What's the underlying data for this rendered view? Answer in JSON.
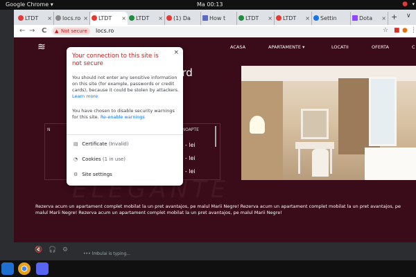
{
  "system": {
    "app_name": "Google Chrome",
    "app_menu_arrow": "▾",
    "clock": "Ma 00:13",
    "status_icon": "●",
    "sysmenu_arrow": "▾"
  },
  "browser": {
    "tabs": [
      {
        "label": "LTDT",
        "favicon_color": "#e53935",
        "active": false
      },
      {
        "label": "locs.ro",
        "favicon_color": "#888888",
        "active": false
      },
      {
        "label": "LTDT",
        "favicon_color": "#e53935",
        "active": true
      },
      {
        "label": "LTDT",
        "favicon_color": "#1e8e3e",
        "active": false
      },
      {
        "label": "(1) Da",
        "favicon_color": "#e53935",
        "active": false
      },
      {
        "label": "How t",
        "favicon_color": "#5c6bc0",
        "active": false
      },
      {
        "label": "LTDT",
        "favicon_color": "#1e8e3e",
        "active": false
      },
      {
        "label": "LTDT",
        "favicon_color": "#e53935",
        "active": false
      },
      {
        "label": "Settin",
        "favicon_color": "#1a73e8",
        "active": false
      },
      {
        "label": "Dota",
        "favicon_color": "#9146ff",
        "active": false
      }
    ],
    "tab_close": "×",
    "new_tab": "+",
    "window_controls": "∨",
    "nav": {
      "back": "←",
      "forward": "→",
      "reload": "C"
    },
    "security_chip": "Not secure",
    "security_warn_icon": "▲",
    "url": "locs.ro",
    "toolbar_icons": {
      "star": "☆",
      "ext1": "■",
      "ext2": "●",
      "profile": "●",
      "menu": "⋮"
    }
  },
  "site": {
    "logo_icon": "≋",
    "nav": [
      "ACASA",
      "APARTAMENTE ▾",
      "LOCATII",
      "OFERTA",
      "C"
    ],
    "heading": "Nord",
    "table_header_left": "N",
    "table_header_right": "TARIF NOAPTE",
    "prices": [
      "- - - lei",
      "- - - lei",
      "- - - lei"
    ],
    "watermark": "ELEGANTE",
    "promo": "Rezerva acum un apartament complet mobilat la un pret avantajos, pe malul Marii Negre! Rezerva acum un apartament complet mobilat la un pret avantajos, pe malul Marii Negre! Rezerva acum un apartament complet mobilat la un pret avantajos, pe malul Marii Negre!"
  },
  "popup": {
    "close": "×",
    "title": "Your connection to this site is not secure",
    "p1": "You should not enter any sensitive information on this site (for example, passwords or credit cards), because it could be stolen by attackers.",
    "p1_link": "Learn more",
    "p2": "You have chosen to disable security warnings for this site.",
    "p2_link": "Re-enable warnings",
    "items": [
      {
        "label": "Certificate",
        "sub": "(Invalid)",
        "icon": "▤"
      },
      {
        "label": "Cookies",
        "sub": "(1 in use)",
        "icon": "◔"
      },
      {
        "label": "Site settings",
        "sub": "",
        "icon": "⚙"
      }
    ]
  },
  "desktop": {
    "typing_text": "••• lmbulai is typing..."
  },
  "dock": {
    "apps": [
      {
        "name": "vscode",
        "color": "#1f6fd1"
      },
      {
        "name": "chrome",
        "color": "#e8a317"
      },
      {
        "name": "discord",
        "color": "#5865f2"
      }
    ]
  }
}
